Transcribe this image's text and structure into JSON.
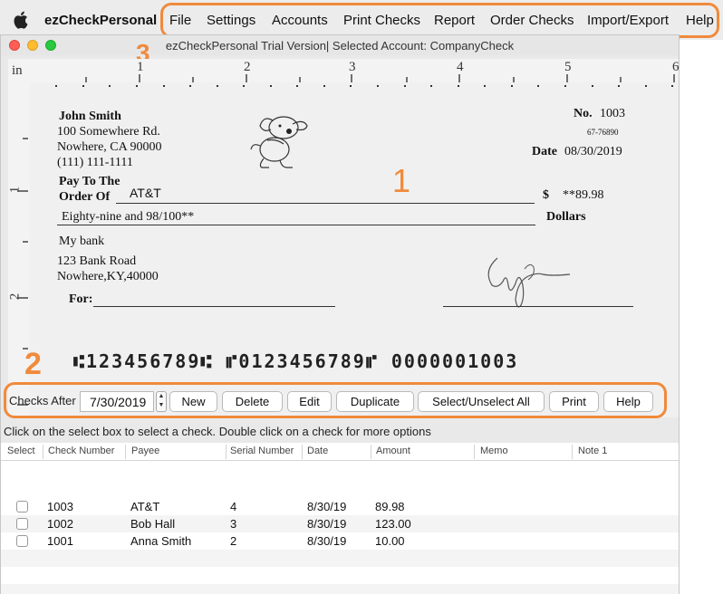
{
  "menubar": {
    "app_name": "ezCheckPersonal",
    "items": [
      "File",
      "Settings",
      "Accounts",
      "Print Checks",
      "Report",
      "Order Checks",
      "Import/Export",
      "Help"
    ]
  },
  "window": {
    "title": "ezCheckPersonal Trial Version| Selected Account: CompanyCheck"
  },
  "annotations": {
    "a1": "1",
    "a2": "2",
    "a3": "3",
    "color": "#f08a3c"
  },
  "ruler": {
    "unit": "in",
    "h_numbers": [
      "1",
      "2",
      "3",
      "4",
      "5",
      "6"
    ],
    "v_numbers": [
      "1",
      "2"
    ]
  },
  "check": {
    "payer": {
      "name": "John Smith",
      "address1": "100 Somewhere Rd.",
      "address2": "Nowhere, CA 90000",
      "phone": "(111) 111-1111"
    },
    "no_label": "No.",
    "number": "1003",
    "fraction": "67-76890",
    "date_label": "Date",
    "date": "08/30/2019",
    "pay_to_label_1": "Pay To The",
    "pay_to_label_2": "Order Of",
    "payee": "AT&T",
    "currency": "$",
    "amount": "**89.98",
    "amount_words": "Eighty-nine and 98/100**",
    "dollars_label": "Dollars",
    "bank": {
      "name": "My bank",
      "address1": "123 Bank Road",
      "address2": "Nowhere,KY,40000"
    },
    "for_label": "For:",
    "micr": "⑆123456789⑆ ⑈0123456789⑈ 0000001003"
  },
  "toolbar": {
    "checks_after_label": "Checks After",
    "date_value": "7/30/2019",
    "buttons": [
      "New",
      "Delete",
      "Edit",
      "Duplicate",
      "Select/Unselect All",
      "Print",
      "Help"
    ]
  },
  "hint": "Click on the select box to select a check. Double click on a check for more options",
  "table": {
    "columns": [
      "Select",
      "Check Number",
      "Payee",
      "Serial Number",
      "Date",
      "Amount",
      "Memo",
      "Note 1"
    ],
    "rows": [
      {
        "check_number": "1003",
        "payee": "AT&T",
        "serial": "4",
        "date": "8/30/19",
        "amount": "89.98",
        "memo": "",
        "note": ""
      },
      {
        "check_number": "1002",
        "payee": "Bob Hall",
        "serial": "3",
        "date": "8/30/19",
        "amount": "123.00",
        "memo": "",
        "note": ""
      },
      {
        "check_number": "1001",
        "payee": "Anna Smith",
        "serial": "2",
        "date": "8/30/19",
        "amount": "10.00",
        "memo": "",
        "note": ""
      }
    ]
  }
}
